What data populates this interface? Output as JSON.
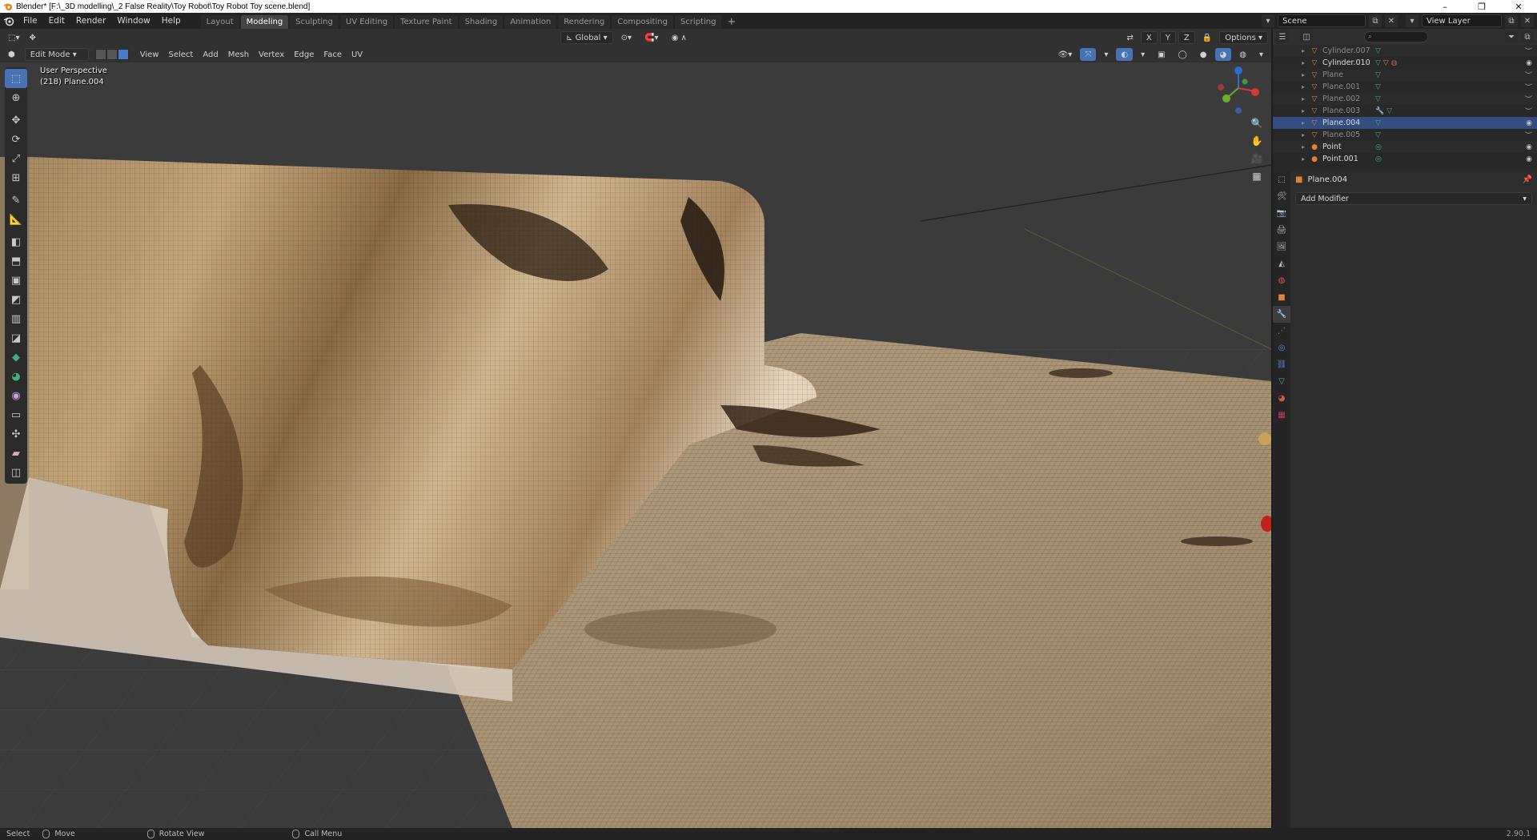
{
  "window": {
    "title": "Blender* [F:\\_3D modelling\\_2 False Reality\\Toy Robot\\Toy Robot Toy scene.blend]",
    "controls": [
      "–",
      "❐",
      "✕"
    ]
  },
  "menu": [
    "File",
    "Edit",
    "Render",
    "Window",
    "Help"
  ],
  "workspaces": {
    "tabs": [
      "Layout",
      "Modeling",
      "Sculpting",
      "UV Editing",
      "Texture Paint",
      "Shading",
      "Animation",
      "Rendering",
      "Compositing",
      "Scripting"
    ],
    "active": "Modeling",
    "add": "+"
  },
  "scene": {
    "name": "Scene",
    "view_layer": "View Layer"
  },
  "viewport": {
    "mode": "Edit Mode",
    "header_menus": [
      "View",
      "Select",
      "Add",
      "Mesh",
      "Vertex",
      "Edge",
      "Face",
      "UV"
    ],
    "orientation": "Global",
    "options": "Options",
    "perspective_label": "User Perspective",
    "object_label": "(218) Plane.004",
    "xyz": [
      "X",
      "Y",
      "Z"
    ]
  },
  "outliner": {
    "rows": [
      {
        "name": "Cylinder.007",
        "visible": false,
        "selected": false
      },
      {
        "name": "Cylinder.010",
        "visible": true,
        "selected": false
      },
      {
        "name": "Plane",
        "visible": false,
        "selected": false
      },
      {
        "name": "Plane.001",
        "visible": false,
        "selected": false
      },
      {
        "name": "Plane.002",
        "visible": false,
        "selected": false
      },
      {
        "name": "Plane.003",
        "visible": false,
        "selected": false
      },
      {
        "name": "Plane.004",
        "visible": true,
        "selected": true
      },
      {
        "name": "Plane.005",
        "visible": false,
        "selected": false
      },
      {
        "name": "Point",
        "visible": true,
        "selected": false
      },
      {
        "name": "Point.001",
        "visible": true,
        "selected": false
      }
    ]
  },
  "properties": {
    "object_name": "Plane.004",
    "add_modifier": "Add Modifier"
  },
  "status": {
    "select": "Select",
    "move": "Move",
    "rotate": "Rotate View",
    "call_menu": "Call Menu",
    "version": "2.90.1"
  },
  "colors": {
    "accent": "#4772b3",
    "selected_row": "#334d80",
    "object_orange": "#e0823b",
    "data_green": "#3fae79"
  }
}
